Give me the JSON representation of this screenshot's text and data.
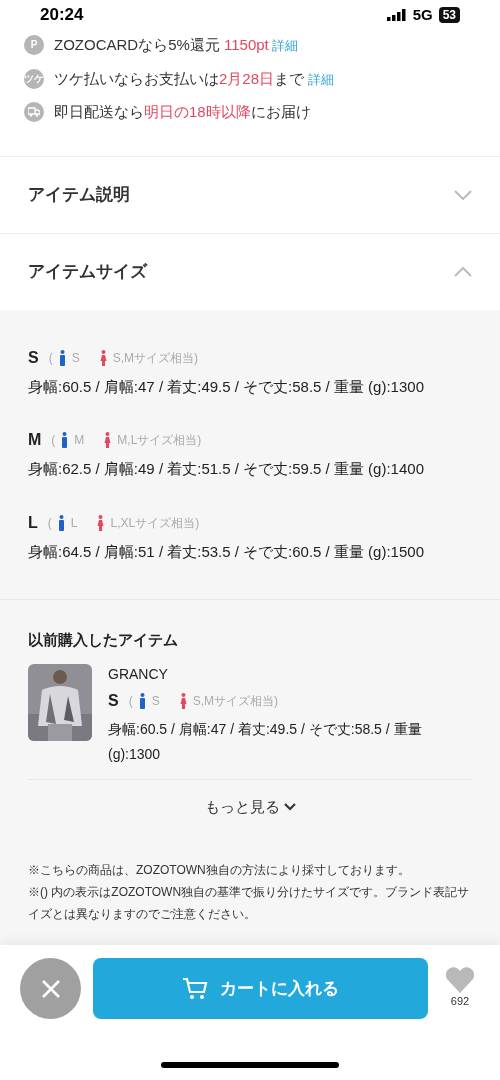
{
  "status_bar": {
    "time": "20:24",
    "network": "5G",
    "battery": "53"
  },
  "perks": [
    {
      "kind": "badge",
      "badge": "P",
      "segments": [
        {
          "kind": "plain",
          "text": "ZOZOCARDなら5%還元 "
        },
        {
          "kind": "accent",
          "text": "1150pt"
        },
        {
          "kind": "link",
          "text": " 詳細"
        }
      ]
    },
    {
      "kind": "badge",
      "badge": "ツケ",
      "segments": [
        {
          "kind": "plain",
          "text": "ツケ払いならお支払いは"
        },
        {
          "kind": "accent",
          "text": "2月28日"
        },
        {
          "kind": "plain",
          "text": "まで "
        },
        {
          "kind": "link",
          "text": "詳細"
        }
      ]
    },
    {
      "kind": "truck",
      "segments": [
        {
          "kind": "plain",
          "text": "即日配送なら"
        },
        {
          "kind": "accent",
          "text": "明日の18時以降"
        },
        {
          "kind": "plain",
          "text": "にお届け"
        }
      ]
    }
  ],
  "sections": [
    {
      "title": "アイテム説明",
      "expanded": false
    },
    {
      "title": "アイテムサイズ",
      "expanded": true
    }
  ],
  "sizes": [
    {
      "size": "S",
      "open": "(",
      "male": "S",
      "female": "S,Mサイズ相当)",
      "measurements": "身幅:60.5 / 肩幅:47 / 着丈:49.5 / そで丈:58.5 / 重量 (g):1300"
    },
    {
      "size": "M",
      "open": "(",
      "male": "M",
      "female": "M,Lサイズ相当)",
      "measurements": "身幅:62.5 / 肩幅:49 / 着丈:51.5 / そで丈:59.5 / 重量 (g):1400"
    },
    {
      "size": "L",
      "open": "(",
      "male": "L",
      "female": "L,XLサイズ相当)",
      "measurements": "身幅:64.5 / 肩幅:51 / 着丈:53.5 / そで丈:60.5 / 重量 (g):1500"
    }
  ],
  "purchased": {
    "title": "以前購入したアイテム",
    "items": [
      {
        "kind": "picture",
        "brand": "GRANCY",
        "size": "S",
        "open": "(",
        "male": "S",
        "female": "S,Mサイズ相当)",
        "measurements": "身幅:60.5 / 肩幅:47 / 着丈:49.5 / そで丈:58.5 / 重量 (g):1300"
      }
    ],
    "more": "もっと見る"
  },
  "notes": [
    "※こちらの商品は、ZOZOTOWN独自の方法により採寸しております。",
    "※() 内の表示はZOZOTOWN独自の基準で振り分けたサイズです。ブランド表記サイズとは異なりますのでご注意ください。"
  ],
  "bottom_bar": {
    "cart_label": "カートに入れる",
    "favorites": "692"
  }
}
